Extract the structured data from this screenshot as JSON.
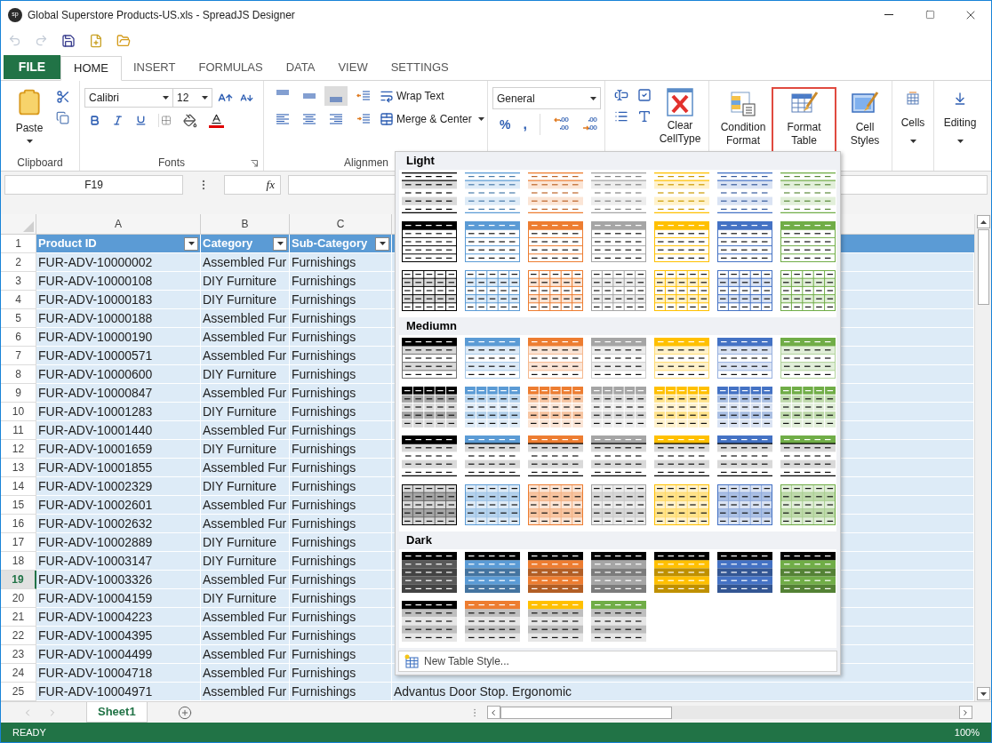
{
  "window": {
    "logo": "sp",
    "title": "Global Superstore Products-US.xls - SpreadJS Designer"
  },
  "quick_access": [
    {
      "kind": "undo",
      "disabled": true
    },
    {
      "kind": "redo",
      "disabled": true
    },
    {
      "kind": "save",
      "disabled": false
    },
    {
      "kind": "new",
      "disabled": false
    },
    {
      "kind": "open",
      "disabled": false
    }
  ],
  "file_tab": "FILE",
  "tabs": [
    {
      "label": "HOME",
      "selected": true
    },
    {
      "label": "INSERT",
      "selected": false
    },
    {
      "label": "FORMULAS",
      "selected": false
    },
    {
      "label": "DATA",
      "selected": false
    },
    {
      "label": "VIEW",
      "selected": false
    },
    {
      "label": "SETTINGS",
      "selected": false
    }
  ],
  "ribbon": {
    "clipboard": {
      "label": "Clipboard",
      "paste": "Paste"
    },
    "fonts": {
      "label": "Fonts",
      "font": "Calibri",
      "size": "12"
    },
    "alignment": {
      "label": "Alignmen",
      "vertical": [
        {
          "kind": "top",
          "selected": false
        },
        {
          "kind": "middle",
          "selected": false
        },
        {
          "kind": "bottom",
          "selected": true
        }
      ],
      "wrap": "Wrap Text",
      "merge": "Merge & Center"
    },
    "number": {
      "format": "General",
      "percent": "%",
      "comma": ","
    },
    "cell_type": {
      "clear": "Clear CellType"
    },
    "styles": [
      {
        "kind": "conditional",
        "label": "Condition Format",
        "selected": false
      },
      {
        "kind": "table",
        "label": "Format Table",
        "selected": true
      },
      {
        "kind": "cell",
        "label": "Cell Styles",
        "selected": false
      }
    ],
    "cells": "Cells",
    "editing": "Editing"
  },
  "formula_bar": {
    "name_box": "F19",
    "fx": "fx"
  },
  "grid": {
    "columns": [
      "A",
      "B",
      "C"
    ],
    "header": [
      "Product ID",
      "Category",
      "Sub-Category"
    ],
    "rows": [
      {
        "num": "2",
        "selected": false,
        "cells": [
          "FUR-ADV-10000002",
          "Assembled Fur",
          "Furnishings"
        ]
      },
      {
        "num": "3",
        "selected": false,
        "cells": [
          "FUR-ADV-10000108",
          "DIY Furniture",
          "Furnishings"
        ]
      },
      {
        "num": "4",
        "selected": false,
        "cells": [
          "FUR-ADV-10000183",
          "DIY Furniture",
          "Furnishings"
        ]
      },
      {
        "num": "5",
        "selected": false,
        "cells": [
          "FUR-ADV-10000188",
          "Assembled Fur",
          "Furnishings"
        ]
      },
      {
        "num": "6",
        "selected": false,
        "cells": [
          "FUR-ADV-10000190",
          "Assembled Fur",
          "Furnishings"
        ]
      },
      {
        "num": "7",
        "selected": false,
        "cells": [
          "FUR-ADV-10000571",
          "Assembled Fur",
          "Furnishings"
        ]
      },
      {
        "num": "8",
        "selected": false,
        "cells": [
          "FUR-ADV-10000600",
          "DIY Furniture",
          "Furnishings"
        ]
      },
      {
        "num": "9",
        "selected": false,
        "cells": [
          "FUR-ADV-10000847",
          "Assembled Fur",
          "Furnishings"
        ]
      },
      {
        "num": "10",
        "selected": false,
        "cells": [
          "FUR-ADV-10001283",
          "DIY Furniture",
          "Furnishings"
        ]
      },
      {
        "num": "11",
        "selected": false,
        "cells": [
          "FUR-ADV-10001440",
          "Assembled Fur",
          "Furnishings"
        ]
      },
      {
        "num": "12",
        "selected": false,
        "cells": [
          "FUR-ADV-10001659",
          "DIY Furniture",
          "Furnishings"
        ]
      },
      {
        "num": "13",
        "selected": false,
        "cells": [
          "FUR-ADV-10001855",
          "Assembled Fur",
          "Furnishings"
        ]
      },
      {
        "num": "14",
        "selected": false,
        "cells": [
          "FUR-ADV-10002329",
          "DIY Furniture",
          "Furnishings"
        ]
      },
      {
        "num": "15",
        "selected": false,
        "cells": [
          "FUR-ADV-10002601",
          "Assembled Fur",
          "Furnishings"
        ]
      },
      {
        "num": "16",
        "selected": false,
        "cells": [
          "FUR-ADV-10002632",
          "Assembled Fur",
          "Furnishings"
        ]
      },
      {
        "num": "17",
        "selected": false,
        "cells": [
          "FUR-ADV-10002889",
          "DIY Furniture",
          "Furnishings"
        ]
      },
      {
        "num": "18",
        "selected": false,
        "cells": [
          "FUR-ADV-10003147",
          "DIY Furniture",
          "Furnishings"
        ]
      },
      {
        "num": "19",
        "selected": true,
        "cells": [
          "FUR-ADV-10003326",
          "Assembled Fur",
          "Furnishings"
        ]
      },
      {
        "num": "20",
        "selected": false,
        "cells": [
          "FUR-ADV-10004159",
          "DIY Furniture",
          "Furnishings"
        ]
      },
      {
        "num": "21",
        "selected": false,
        "cells": [
          "FUR-ADV-10004223",
          "Assembled Fur",
          "Furnishings"
        ]
      },
      {
        "num": "22",
        "selected": false,
        "cells": [
          "FUR-ADV-10004395",
          "Assembled Fur",
          "Furnishings"
        ]
      },
      {
        "num": "23",
        "selected": false,
        "cells": [
          "FUR-ADV-10004499",
          "Assembled Fur",
          "Furnishings"
        ]
      },
      {
        "num": "24",
        "selected": false,
        "cells": [
          "FUR-ADV-10004718",
          "Assembled Fur",
          "Furnishings"
        ]
      },
      {
        "num": "25",
        "selected": false,
        "cells": [
          "FUR-ADV-10004971",
          "Assembled Fur",
          "Furnishings",
          "Advantus Door Stop. Ergonomic"
        ]
      }
    ],
    "header_num": "1"
  },
  "sheet_tabs": [
    {
      "label": "Sheet1",
      "selected": true
    }
  ],
  "status_bar": {
    "state": "READY",
    "zoom": "100%"
  },
  "table_style_gallery": {
    "sections": [
      {
        "title": "Light",
        "rows": [
          {
            "kind": "banded-lines",
            "swatches": [
              {
                "color": "#000000"
              },
              {
                "color": "#5b9bd5"
              },
              {
                "color": "#ed7d31"
              },
              {
                "color": "#a5a5a5"
              },
              {
                "color": "#ffc000"
              },
              {
                "color": "#4472c4"
              },
              {
                "color": "#70ad47"
              }
            ]
          },
          {
            "kind": "header-bordered",
            "swatches": [
              {
                "color": "#000000"
              },
              {
                "color": "#5b9bd5"
              },
              {
                "color": "#ed7d31"
              },
              {
                "color": "#a5a5a5"
              },
              {
                "color": "#ffc000"
              },
              {
                "color": "#4472c4"
              },
              {
                "color": "#70ad47"
              }
            ]
          },
          {
            "kind": "grid-banded",
            "swatches": [
              {
                "color": "#000000"
              },
              {
                "color": "#5b9bd5"
              },
              {
                "color": "#ed7d31"
              },
              {
                "color": "#a5a5a5"
              },
              {
                "color": "#ffc000"
              },
              {
                "color": "#4472c4"
              },
              {
                "color": "#70ad47"
              }
            ]
          }
        ]
      },
      {
        "title": "Mediumn",
        "rows": [
          {
            "kind": "header-banded",
            "swatches": [
              {
                "color": "#000000"
              },
              {
                "color": "#5b9bd5"
              },
              {
                "color": "#ed7d31"
              },
              {
                "color": "#a5a5a5"
              },
              {
                "color": "#ffc000"
              },
              {
                "color": "#4472c4"
              },
              {
                "color": "#70ad47"
              }
            ]
          },
          {
            "kind": "header-grid-banded",
            "swatches": [
              {
                "color": "#000000"
              },
              {
                "color": "#5b9bd5"
              },
              {
                "color": "#ed7d31"
              },
              {
                "color": "#a5a5a5"
              },
              {
                "color": "#ffc000"
              },
              {
                "color": "#4472c4"
              },
              {
                "color": "#70ad47"
              }
            ]
          },
          {
            "kind": "header-black-rule",
            "swatches": [
              {
                "color": "#000000"
              },
              {
                "color": "#5b9bd5"
              },
              {
                "color": "#ed7d31"
              },
              {
                "color": "#a5a5a5"
              },
              {
                "color": "#ffc000"
              },
              {
                "color": "#4472c4"
              },
              {
                "color": "#70ad47"
              }
            ]
          },
          {
            "kind": "grid-filled",
            "swatches": [
              {
                "color": "#000000"
              },
              {
                "color": "#5b9bd5"
              },
              {
                "color": "#ed7d31"
              },
              {
                "color": "#a5a5a5"
              },
              {
                "color": "#ffc000"
              },
              {
                "color": "#4472c4"
              },
              {
                "color": "#70ad47"
              }
            ]
          }
        ]
      },
      {
        "title": "Dark",
        "rows": [
          {
            "kind": "dark-banded",
            "swatches": [
              {
                "color": "#595959"
              },
              {
                "color": "#5b9bd5"
              },
              {
                "color": "#ed7d31"
              },
              {
                "color": "#a5a5a5"
              },
              {
                "color": "#ffc000"
              },
              {
                "color": "#4472c4"
              },
              {
                "color": "#70ad47"
              }
            ]
          },
          {
            "kind": "dark-header-light",
            "swatches": [
              {
                "color": "#000000"
              },
              {
                "color": "#ed7d31"
              },
              {
                "color": "#ffc000"
              },
              {
                "color": "#70ad47"
              }
            ]
          }
        ]
      }
    ],
    "footer": "New Table Style..."
  }
}
